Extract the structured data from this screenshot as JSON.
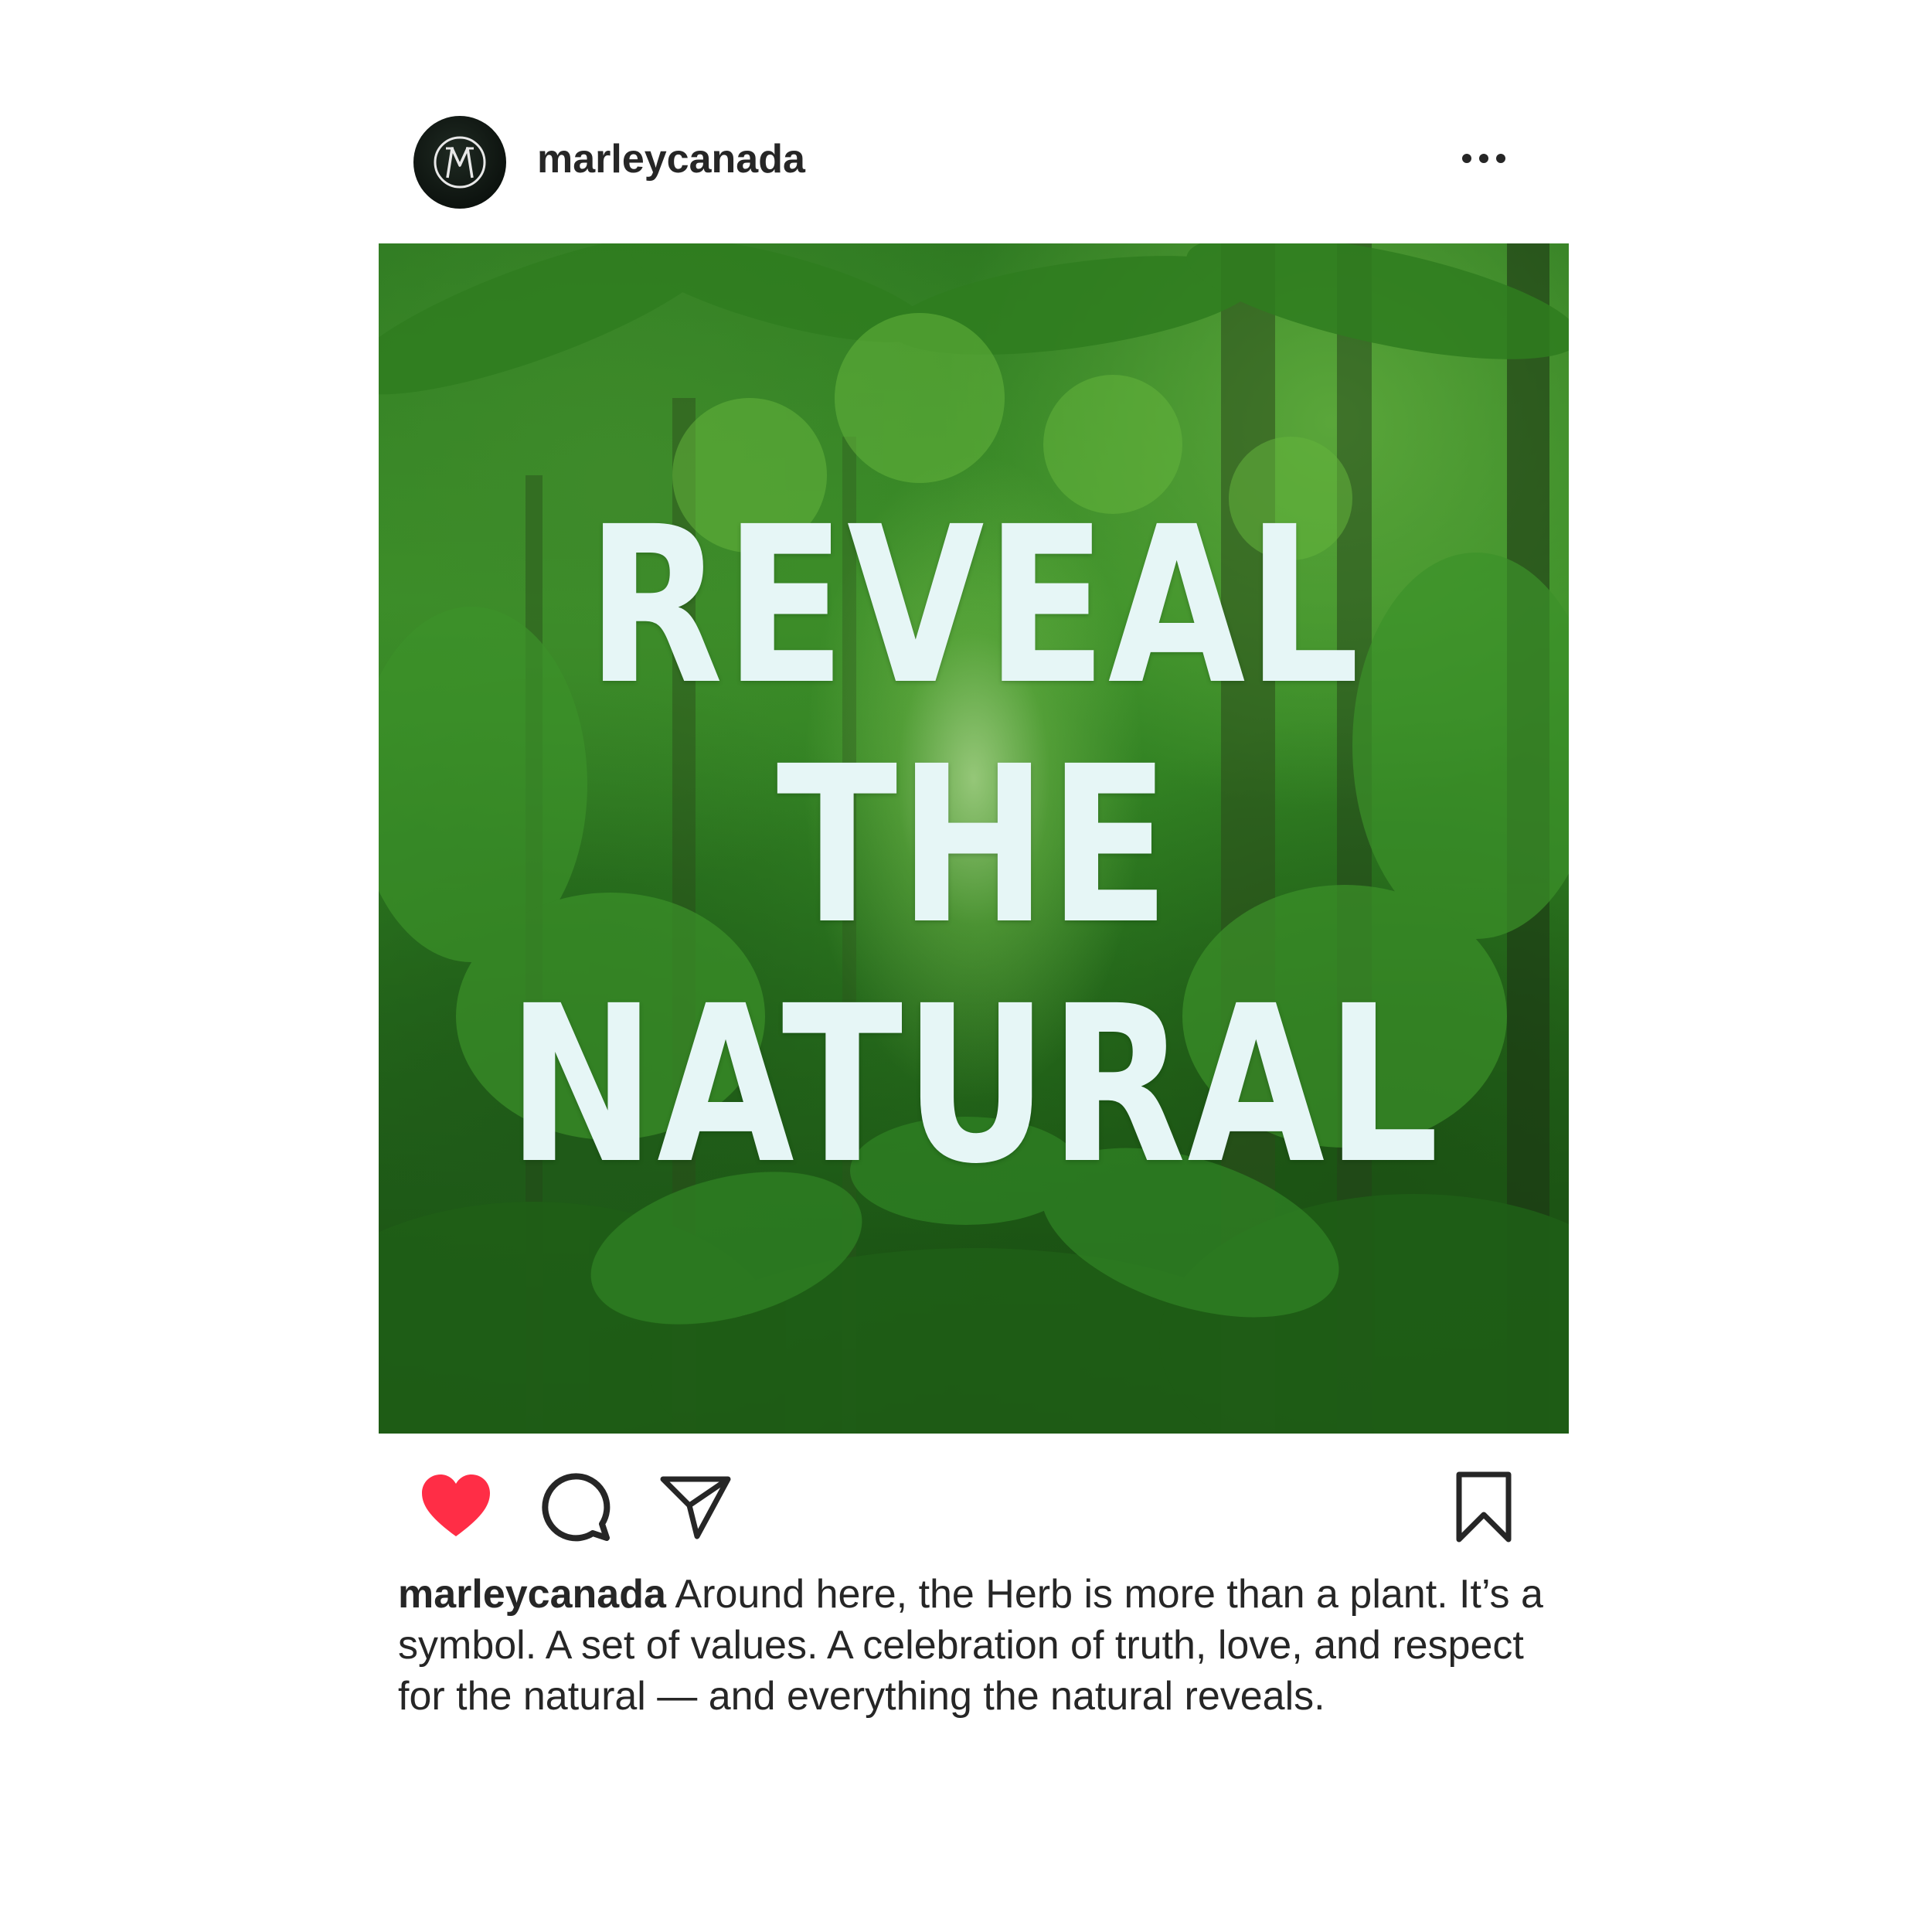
{
  "post": {
    "username": "marleycanada",
    "avatar_icon": "marley-logo-icon",
    "more_icon": "more-options-icon",
    "image": {
      "overlay_lines": [
        "REVEAL",
        "THE",
        "NATURAL"
      ]
    },
    "actions": {
      "like_icon": "heart-filled-icon",
      "like_color": "#ff2d46",
      "comment_icon": "comment-icon",
      "share_icon": "paper-plane-icon",
      "save_icon": "bookmark-icon"
    },
    "caption": {
      "username": "marleycanada",
      "text": "Around here, the Herb is more than a plant. It’s a symbol. A set of values. A celebration of truth, love, and respect for the natural — and everything the natural reveals."
    }
  }
}
